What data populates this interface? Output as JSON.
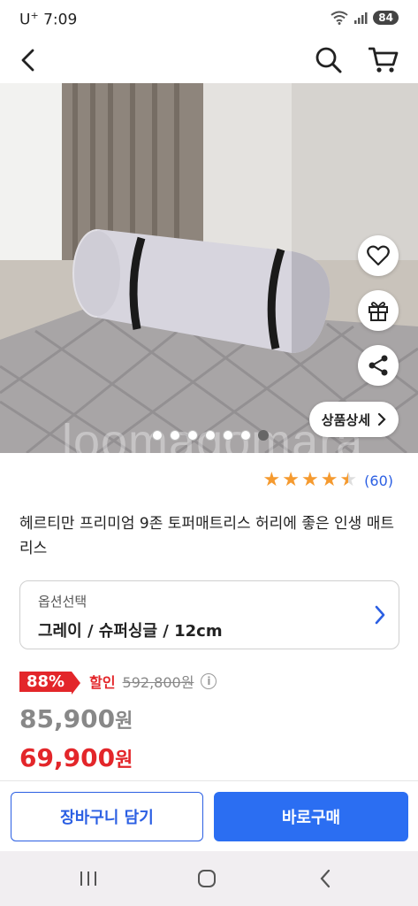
{
  "status": {
    "carrier": "U",
    "carrier_sup": "+",
    "time": "7:09",
    "battery": "84"
  },
  "header": {
    "back_icon": "chevron-left-icon",
    "search_icon": "search-icon",
    "cart_icon": "cart-icon"
  },
  "hero": {
    "watermark": "loomagomara",
    "detail_button": "상품상세",
    "slide_count": 7,
    "active_slide": 7
  },
  "rating": {
    "stars": 4.5,
    "count": "(60)"
  },
  "product": {
    "title": "헤르티만 프리미엄 9존 토퍼매트리스 허리에 좋은 인생 매트리스"
  },
  "option": {
    "label": "옵션선택",
    "value": "그레이 / 슈퍼싱글 / 12cm"
  },
  "pricing": {
    "discount_rate": "88%",
    "discount_label": "할인",
    "original_price": "592,800원",
    "sale_price_number": "85,900",
    "sale_price_unit": "원",
    "final_price_number": "69,900",
    "final_price_unit": "원"
  },
  "actions": {
    "cart_button": "장바구니 담기",
    "buy_button": "바로구매"
  },
  "colors": {
    "accent_blue": "#2b6ef2",
    "discount_red": "#e3262a",
    "star_orange": "#f59a2f"
  }
}
